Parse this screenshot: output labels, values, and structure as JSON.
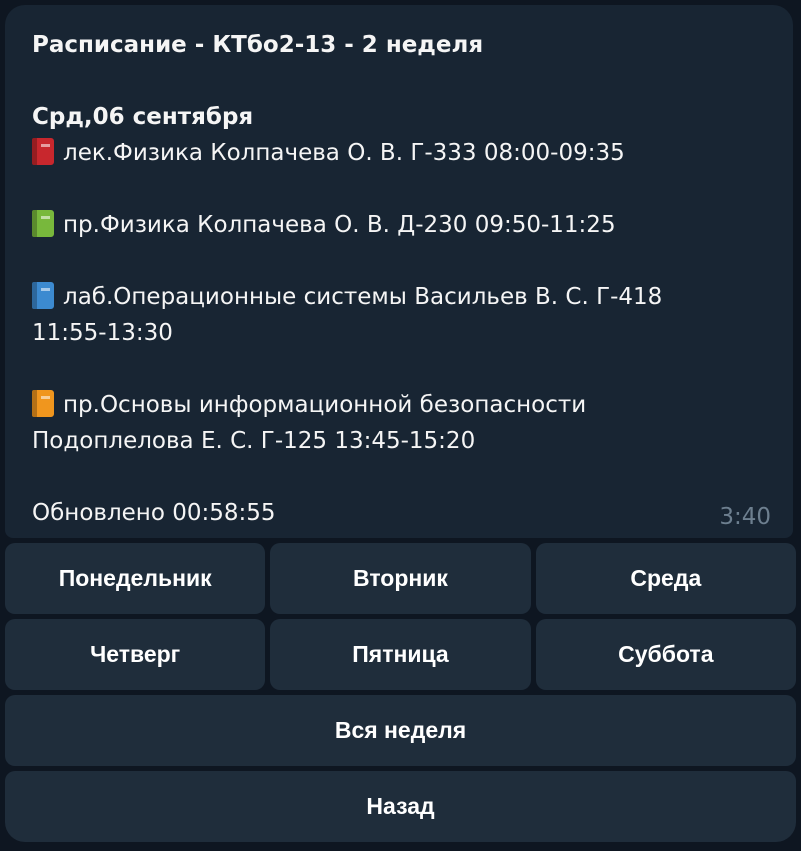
{
  "message": {
    "title": "Расписание - КТбо2-13 - 2 неделя",
    "day_heading": "Срд,06  сентября",
    "lessons": [
      {
        "line1": "лек.Физика Колпачева О. В. Г-333 08:00-09:35",
        "line2": "",
        "icon": "red-book-icon",
        "color": "#c8272d"
      },
      {
        "line1": "пр.Физика Колпачева О. В. Д-230 09:50-11:25",
        "line2": "",
        "icon": "green-book-icon",
        "color": "#78b83c"
      },
      {
        "line1": "лаб.Операционные системы Васильев В. С. Г-418",
        "line2": "11:55-13:30",
        "icon": "blue-book-icon",
        "color": "#3c8ad0"
      },
      {
        "line1": "пр.Основы информационной безопасности",
        "line2": "Подоплелова Е. С. Г-125 13:45-15:20",
        "icon": "orange-book-icon",
        "color": "#f0961e"
      }
    ],
    "updated": "Обновлено 00:58:55",
    "time": "3:40"
  },
  "keyboard": {
    "monday": "Понедельник",
    "tuesday": "Вторник",
    "wednesday": "Среда",
    "thursday": "Четверг",
    "friday": "Пятница",
    "saturday": "Суббота",
    "whole_week": "Вся неделя",
    "back": "Назад"
  }
}
